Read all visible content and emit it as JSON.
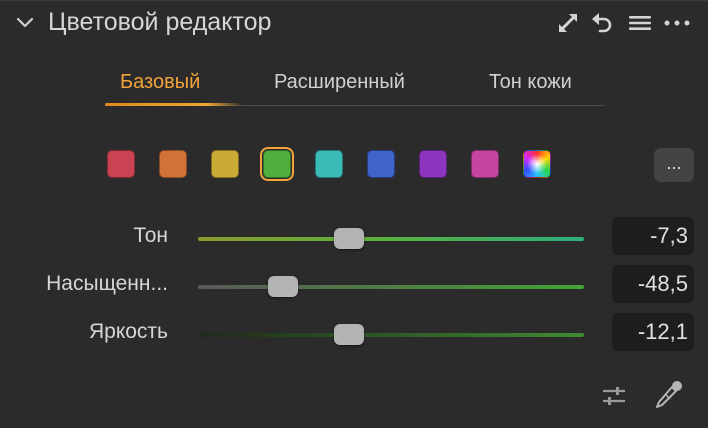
{
  "panel": {
    "title": "Цветовой редактор"
  },
  "header_icons": [
    "expand-icon",
    "reset-icon",
    "menu-icon",
    "more-icon"
  ],
  "tabs": [
    {
      "label": "Базовый",
      "active": true
    },
    {
      "label": "Расширенный",
      "active": false
    },
    {
      "label": "Тон кожи",
      "active": false
    }
  ],
  "swatches": [
    {
      "name": "red",
      "color": "#c94352"
    },
    {
      "name": "orange",
      "color": "#d17339"
    },
    {
      "name": "yellow",
      "color": "#c9ab36"
    },
    {
      "name": "green",
      "color": "#4fae3c",
      "selected": true
    },
    {
      "name": "aqua",
      "color": "#3bbbb6"
    },
    {
      "name": "blue",
      "color": "#3e63c9"
    },
    {
      "name": "purple",
      "color": "#8c35bf"
    },
    {
      "name": "magenta",
      "color": "#c444a0"
    },
    {
      "name": "all",
      "color": "rainbow"
    }
  ],
  "more_button": {
    "label": "..."
  },
  "sliders": [
    {
      "label": "Тон",
      "value": "-7,3",
      "position": 0.39
    },
    {
      "label": "Насыщенн...",
      "value": "-48,5",
      "position": 0.22
    },
    {
      "label": "Яркость",
      "value": "-12,1",
      "position": 0.39
    }
  ],
  "colors": {
    "accent": "#f2a33a",
    "background": "#2b2b2b"
  }
}
